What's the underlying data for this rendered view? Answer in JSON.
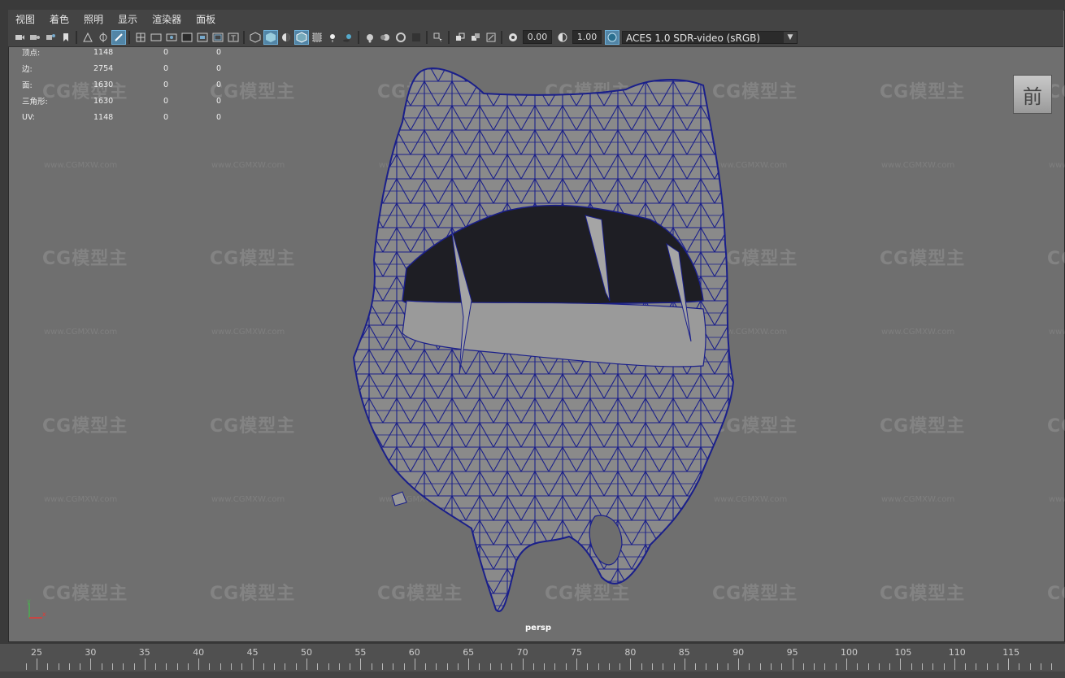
{
  "menu": [
    "视图",
    "着色",
    "照明",
    "显示",
    "渲染器",
    "面板"
  ],
  "toolbar": {
    "exposure_value": "0.00",
    "gamma_value": "1.00",
    "color_space": "ACES 1.0 SDR-video (sRGB)"
  },
  "stats": [
    {
      "label": "顶点:",
      "v1": "1148",
      "v2": "0",
      "v3": "0"
    },
    {
      "label": "边:",
      "v1": "2754",
      "v2": "0",
      "v3": "0"
    },
    {
      "label": "面:",
      "v1": "1630",
      "v2": "0",
      "v3": "0"
    },
    {
      "label": "三角形:",
      "v1": "1630",
      "v2": "0",
      "v3": "0"
    },
    {
      "label": "UV:",
      "v1": "1148",
      "v2": "0",
      "v3": "0"
    }
  ],
  "view_cube_label": "前",
  "camera_label": "persp",
  "axis": {
    "y": "y",
    "x": "x"
  },
  "watermark": {
    "logo": "CG模型主",
    "url": "www.CGMXW.com"
  },
  "timeline": {
    "labels": [
      "25",
      "30",
      "35",
      "40",
      "45",
      "50",
      "55",
      "60",
      "65",
      "70",
      "75",
      "80",
      "85",
      "90",
      "95",
      "100",
      "105",
      "110",
      "115"
    ],
    "start": 25,
    "step": 5
  },
  "colors": {
    "viewport": "#6f6f6f",
    "panel": "#444444",
    "wire": "#1a1f8a",
    "mesh_fill": "#8a8a8a",
    "active_tool": "#5285a6"
  }
}
